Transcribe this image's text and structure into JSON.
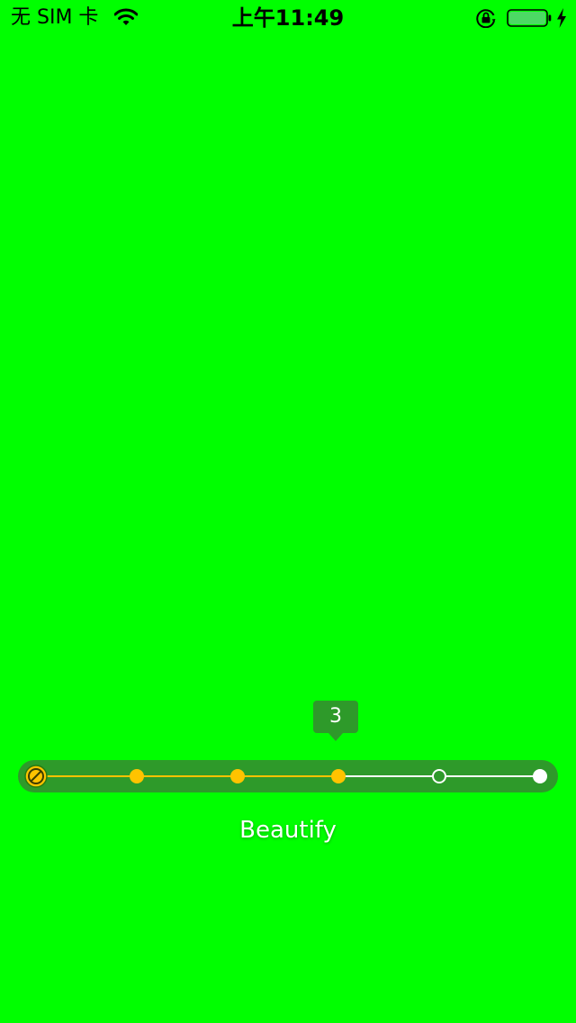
{
  "status_bar": {
    "carrier": "无 SIM 卡",
    "time": "上午11:49",
    "battery_color": "#4cd964",
    "icons": [
      "wifi-icon",
      "lock-rotation-icon",
      "battery-icon",
      "charging-icon"
    ]
  },
  "slider": {
    "value": "3",
    "min": 0,
    "max": 5,
    "selected": 3,
    "active_color": "#ffc300",
    "inactive_color": "#ffffff",
    "track_color": "#2e9a2a",
    "start_icon": "no-filter-icon"
  },
  "filter": {
    "label": "Beautify"
  },
  "background_color": "#00ff00"
}
